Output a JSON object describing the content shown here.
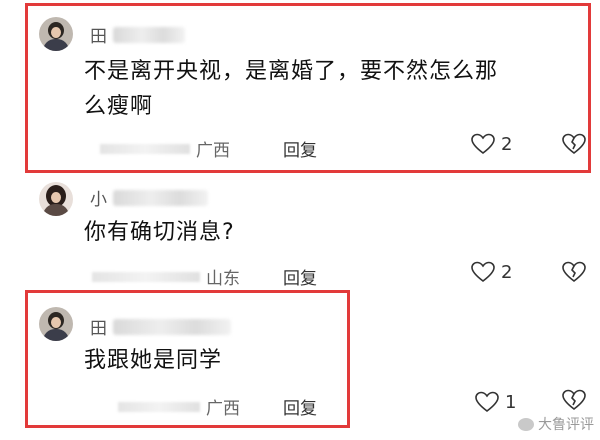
{
  "comments": [
    {
      "username": "田",
      "text_line1": "不是离开央视，是离婚了，要不然怎么那",
      "text_line2": "么瘦啊",
      "location": "广西",
      "reply_label": "回复",
      "like_count": "2",
      "highlighted": true
    },
    {
      "username": "小",
      "text_line1": "你有确切消息?",
      "location": "山东",
      "reply_label": "回复",
      "like_count": "2",
      "highlighted": false
    },
    {
      "username": "田",
      "text_line1": "我跟她是同学",
      "location": "广西",
      "reply_label": "回复",
      "like_count": "1",
      "highlighted": true
    }
  ],
  "watermark": {
    "text": "大鲁评评"
  },
  "colors": {
    "highlight": "#e23a3a",
    "text": "#111111",
    "meta": "#666666"
  }
}
